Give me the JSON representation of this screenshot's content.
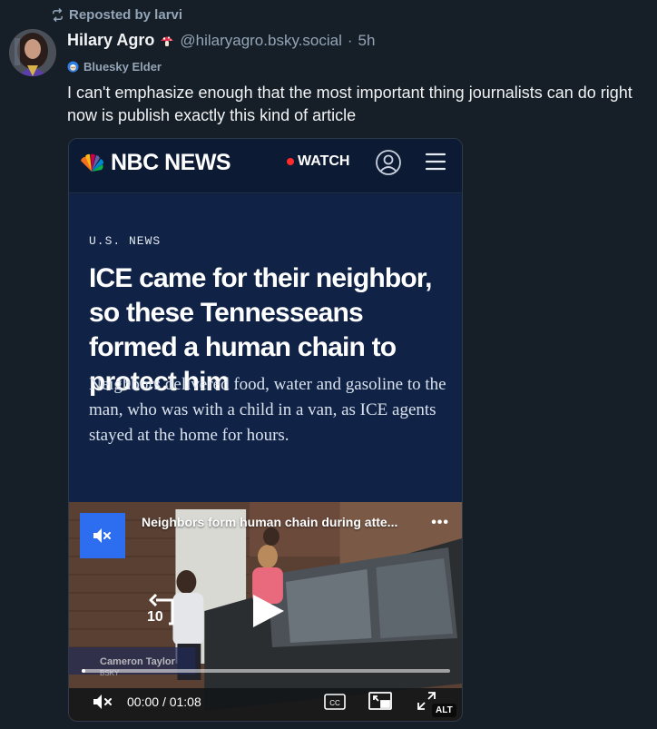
{
  "repost": {
    "text": "Reposted by larvi",
    "icon": "repost-icon"
  },
  "author": {
    "display_name": "Hilary Agro",
    "emoji_icon": "mushroom-icon",
    "handle": "@hilaryagro.bsky.social",
    "separator": "·",
    "time": "5h",
    "badge_label": "Bluesky Elder",
    "badge_icon": "elder-badge-icon"
  },
  "post": {
    "text": "I can't emphasize enough that the most important thing journalists can do right now is publish exactly this kind of article"
  },
  "embed": {
    "brand": "NBC NEWS",
    "watch_label": "WATCH",
    "section": "U.S. NEWS",
    "headline": "ICE came for their neighbor, so these Tennesseans formed a human chain to protect him",
    "dek": "Neighbors delivered food, water and gasoline to the man, who was with a child in a van, as ICE agents stayed at the home for hours.",
    "video": {
      "title": "Neighbors form human chain during atte...",
      "more": "•••",
      "rewind_label": "10",
      "lower_third_name": "Cameron Taylor",
      "lower_third_org": "BSKY",
      "time_current": "00:00",
      "time_separator": "/",
      "time_total": "01:08",
      "progress": 0.0,
      "alt_label": "ALT"
    }
  },
  "colors": {
    "background": "#161e27",
    "muted_text": "#93a5b7",
    "nbc_navy": "#102347",
    "mute_blue": "#2d6df0",
    "watch_red": "#ff2a2a"
  }
}
